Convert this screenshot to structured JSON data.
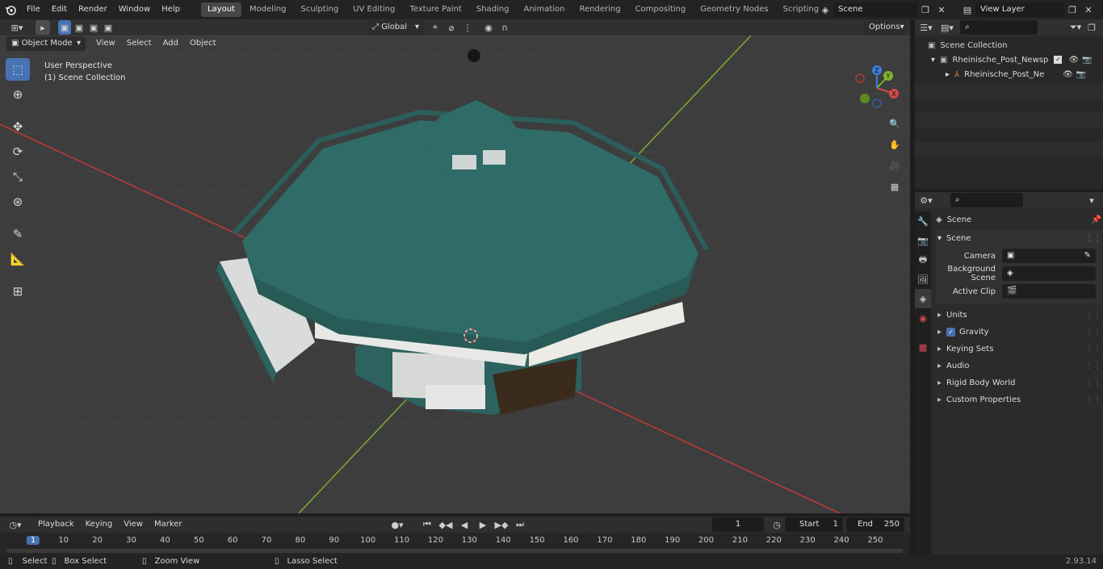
{
  "topbar": {
    "menus": [
      "File",
      "Edit",
      "Render",
      "Window",
      "Help"
    ],
    "workspaces": [
      "Layout",
      "Modeling",
      "Sculpting",
      "UV Editing",
      "Texture Paint",
      "Shading",
      "Animation",
      "Rendering",
      "Compositing",
      "Geometry Nodes",
      "Scripting"
    ],
    "active_workspace": "Layout",
    "add_tab": "+",
    "scene_name": "Scene",
    "view_layer": "View Layer"
  },
  "viewport_header": {
    "mode": "Object Mode",
    "menus": [
      "View",
      "Select",
      "Add",
      "Object"
    ],
    "transform_orientation": "Global",
    "options_label": "Options"
  },
  "viewport": {
    "overlay_title": "User Perspective",
    "overlay_subtitle": "(1) Scene Collection",
    "gizmo": {
      "z": "Z",
      "y": "Y",
      "x": "X"
    },
    "colors": {
      "background": "#3d3d3d",
      "x_axis": "#c33a3a",
      "y_axis": "#7aa62a",
      "kiosk": "#2f6a66"
    }
  },
  "outliner": {
    "root": "Scene Collection",
    "items": [
      {
        "label": "Rheinische_Post_Newspaper_",
        "level": 1
      },
      {
        "label": "Rheinische_Post_Newspa",
        "level": 2
      }
    ]
  },
  "properties": {
    "context": "Scene",
    "panel_title": "Scene",
    "fields": [
      {
        "label": "Camera",
        "value": ""
      },
      {
        "label": "Background Scene",
        "value": ""
      },
      {
        "label": "Active Clip",
        "value": ""
      }
    ],
    "sections": [
      {
        "label": "Units",
        "checkbox": false
      },
      {
        "label": "Gravity",
        "checkbox": true
      },
      {
        "label": "Keying Sets",
        "checkbox": false
      },
      {
        "label": "Audio",
        "checkbox": false
      },
      {
        "label": "Rigid Body World",
        "checkbox": false
      },
      {
        "label": "Custom Properties",
        "checkbox": false
      }
    ]
  },
  "timeline": {
    "menus": [
      "Playback",
      "Keying",
      "View",
      "Marker"
    ],
    "current_frame": "1",
    "start_label": "Start",
    "start": "1",
    "end_label": "End",
    "end": "250",
    "ruler": [
      "1",
      "10",
      "20",
      "30",
      "40",
      "50",
      "60",
      "70",
      "80",
      "90",
      "100",
      "110",
      "120",
      "130",
      "140",
      "150",
      "160",
      "170",
      "180",
      "190",
      "200",
      "210",
      "220",
      "230",
      "240",
      "250"
    ]
  },
  "statusbar": {
    "items": [
      "Select",
      "Box Select",
      "Zoom View",
      "Lasso Select"
    ],
    "version": "2.93.14"
  }
}
